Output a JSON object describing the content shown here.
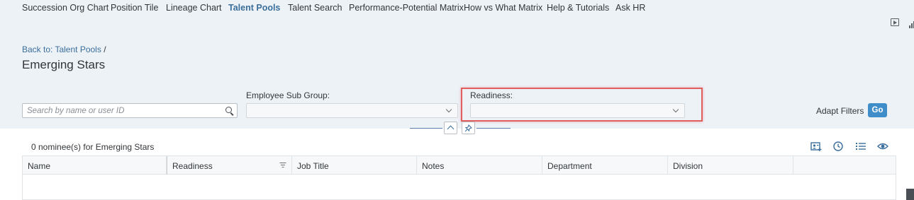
{
  "nav": {
    "items": [
      {
        "label": "Succession Org Chart",
        "active": false
      },
      {
        "label": "Position Tile",
        "active": false
      },
      {
        "label": "Lineage Chart",
        "active": false
      },
      {
        "label": "Talent Pools",
        "active": true
      },
      {
        "label": "Talent Search",
        "active": false
      },
      {
        "label": "Performance-Potential Matrix",
        "active": false
      },
      {
        "label": "How vs What Matrix",
        "active": false
      },
      {
        "label": "Help & Tutorials",
        "active": false
      },
      {
        "label": "Ask HR",
        "active": false
      }
    ]
  },
  "header_icons": [
    "play-icon",
    "chart-bars-icon"
  ],
  "breadcrumb": {
    "link": "Back to: Talent Pools",
    "separator": "/"
  },
  "page": {
    "title": "Emerging Stars"
  },
  "filters": {
    "search": {
      "placeholder": "Search by name or user ID",
      "value": ""
    },
    "employee_sub_group": {
      "label": "Employee Sub Group:",
      "value": ""
    },
    "readiness": {
      "label": "Readiness:",
      "value": ""
    },
    "adapt_filters_label": "Adapt Filters",
    "go_label": "Go"
  },
  "results": {
    "count_text": "0 nominee(s) for Emerging Stars",
    "toolbar_icons": [
      "person-card-icon",
      "history-clock-icon",
      "list-settings-icon",
      "eye-icon"
    ]
  },
  "table": {
    "columns": [
      "Name",
      "Readiness",
      "Job Title",
      "Notes",
      "Department",
      "Division"
    ],
    "rows": []
  },
  "colors": {
    "accent": "#3a6e9c",
    "go_button": "#3f8ec9",
    "highlight": "#e06060",
    "header_bg": "#edf2f7"
  }
}
